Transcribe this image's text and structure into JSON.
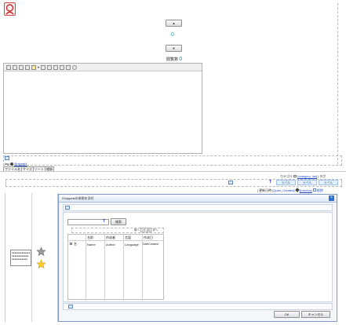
{
  "logo": {
    "icon": "user-avatar-icon"
  },
  "counter": {
    "up": "▲",
    "down": "▼",
    "value": "0",
    "footer_label": "閲覧数",
    "footer_value": "0"
  },
  "editor": {
    "toolbar_icons": [
      "file-icon",
      "edit-icon",
      "copy-icon",
      "paste-icon",
      "text-color-icon",
      "align-icon",
      "list-icon",
      "indent-icon",
      "table-icon",
      "link-icon",
      "smiley-icon"
    ],
    "text_color_caret": "▾"
  },
  "tags_line": {
    "label": "tag",
    "link": "iSnippet4"
  },
  "tabs": [
    "ファイル名",
    "サイズ",
    "ソート",
    "種類"
  ],
  "right_meta": {
    "label": "カテゴリ",
    "category_link": "[category_list]",
    "sep": "|",
    "tag": "タグ"
  },
  "label_chips": [
    "ラベル",
    "ラベル",
    "ラベル"
  ],
  "sort_row": {
    "prefix": "|",
    "sort_label": "更新日時",
    "sort_field": "[Ques_Created]",
    "link": "[Link/ica]",
    "delete": "削除"
  },
  "left_cards": {
    "text": "●●●●●●●●●●●●●●●●",
    "text2": "●●●/●●●/●●●●●",
    "text3": "●●●●●●●●●●●"
  },
  "dialog": {
    "title": "ISnippetsの参照を添付",
    "close": "×",
    "search_button": "検索",
    "pagination": [
      "前へ",
      "1/1 (0)",
      "次へ"
    ],
    "columns": [
      "名前",
      "作成者",
      "言語",
      "作成日"
    ],
    "row_check_label": "名",
    "row": [
      "Name",
      "Author",
      "Language",
      "DateCreated"
    ],
    "ok": "OK",
    "cancel": "キャンセル"
  },
  "colors": {
    "accent_blue": "#1a44c8",
    "counter_teal": "#1a9aa0",
    "label_blue": "#2a5fa8"
  }
}
